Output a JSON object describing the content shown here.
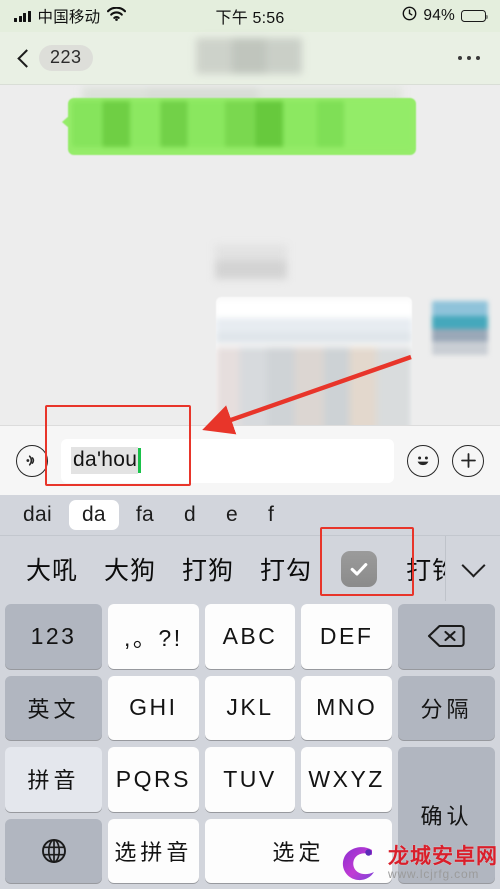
{
  "status_bar": {
    "carrier": "中国移动",
    "time": "下午 5:56",
    "battery_percent": "94%",
    "icons": [
      "signal-bars-icon",
      "wifi-icon",
      "alarm-icon",
      "battery-icon"
    ]
  },
  "nav_bar": {
    "back_badge": "223",
    "back_icon": "chevron-left-icon",
    "more_icon": "more-dots-icon",
    "title": ""
  },
  "input_bar": {
    "voice_icon": "voice-input-icon",
    "input_value": "da'hou",
    "emoji_icon": "emoji-smiley-icon",
    "add_icon": "plus-circle-icon"
  },
  "ime": {
    "pinyin_segments": [
      {
        "label": "dai",
        "active": false
      },
      {
        "label": "da",
        "active": true
      },
      {
        "label": "fa",
        "active": false
      },
      {
        "label": "d",
        "active": false
      },
      {
        "label": "e",
        "active": false
      },
      {
        "label": "f",
        "active": false
      }
    ],
    "candidates": [
      {
        "label": "大吼",
        "type": "text"
      },
      {
        "label": "大狗",
        "type": "text"
      },
      {
        "label": "打狗",
        "type": "text"
      },
      {
        "label": "打勾",
        "type": "text"
      },
      {
        "label": "✅",
        "type": "emoji"
      },
      {
        "label": "打钩",
        "type": "text"
      }
    ],
    "expand_icon": "chevron-down-icon",
    "keys": [
      {
        "label": "123",
        "style": "gray",
        "name": "key-123"
      },
      {
        "label": ",。?!",
        "style": "white",
        "name": "key-punctuation"
      },
      {
        "label": "ABC",
        "style": "white",
        "name": "key-abc"
      },
      {
        "label": "DEF",
        "style": "white",
        "name": "key-def"
      },
      {
        "label": "",
        "style": "gray",
        "name": "key-backspace",
        "icon": "backspace-icon"
      },
      {
        "label": "英文",
        "style": "gray",
        "name": "key-english"
      },
      {
        "label": "GHI",
        "style": "white",
        "name": "key-ghi"
      },
      {
        "label": "JKL",
        "style": "white",
        "name": "key-jkl"
      },
      {
        "label": "MNO",
        "style": "white",
        "name": "key-mno"
      },
      {
        "label": "分隔",
        "style": "gray",
        "name": "key-separator"
      },
      {
        "label": "拼音",
        "style": "light",
        "name": "key-pinyin"
      },
      {
        "label": "PQRS",
        "style": "white",
        "name": "key-pqrs"
      },
      {
        "label": "TUV",
        "style": "white",
        "name": "key-tuv"
      },
      {
        "label": "WXYZ",
        "style": "white",
        "name": "key-wxyz"
      },
      {
        "label": "确认",
        "style": "gray",
        "name": "key-confirm"
      },
      {
        "label": "",
        "style": "gray",
        "name": "key-globe",
        "icon": "globe-icon"
      },
      {
        "label": "选拼音",
        "style": "white",
        "name": "key-select-pinyin"
      },
      {
        "label": "选定",
        "style": "white",
        "name": "key-select"
      }
    ]
  },
  "annotations": {
    "input_highlight": "red-rectangle",
    "candidate_highlight": "red-rectangle",
    "arrow": "red-arrow"
  },
  "watermark": {
    "title": "龙城安卓网",
    "url": "www.lcjrfg.com"
  },
  "colors": {
    "wechat_green": "#95ec69",
    "annotation_red": "#e8352a",
    "caret_green": "#19c24a",
    "keyboard_bg": "#d2d5dc",
    "watermark_red": "#d91f2b"
  }
}
